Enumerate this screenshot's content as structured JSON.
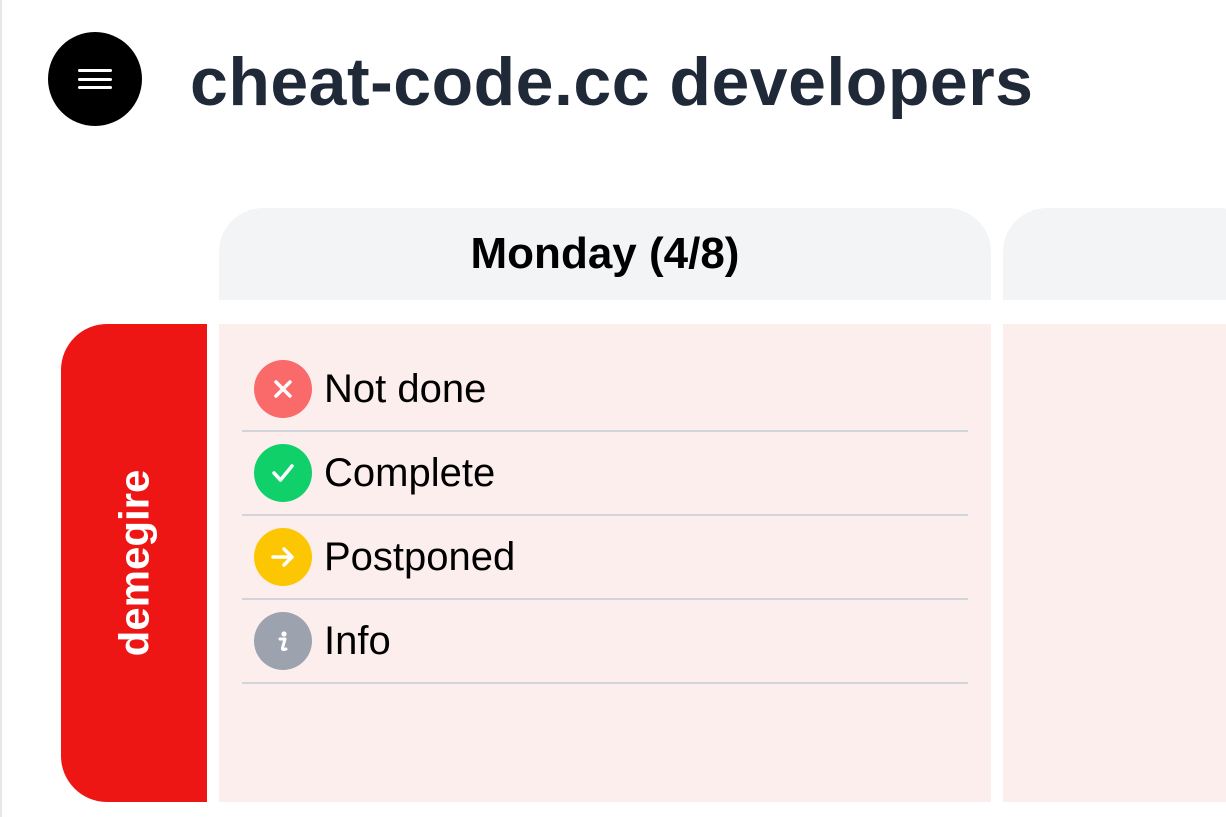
{
  "header": {
    "title": "cheat-code.cc developers"
  },
  "days": [
    {
      "label": "Monday (4/8)"
    },
    {
      "label": ""
    }
  ],
  "user": {
    "name": "demegire"
  },
  "legend": [
    {
      "label": "Not done",
      "icon": "x-icon",
      "color": "#fb6a6a"
    },
    {
      "label": "Complete",
      "icon": "check-icon",
      "color": "#10d06a"
    },
    {
      "label": "Postponed",
      "icon": "arrow-right-icon",
      "color": "#fcc603"
    },
    {
      "label": "Info",
      "icon": "info-icon",
      "color": "#9ca3af"
    }
  ],
  "colors": {
    "user_tab": "#ee1515",
    "cell_bg": "#fdeeee",
    "header_bg": "#f3f4f6",
    "title_text": "#1f2937"
  }
}
